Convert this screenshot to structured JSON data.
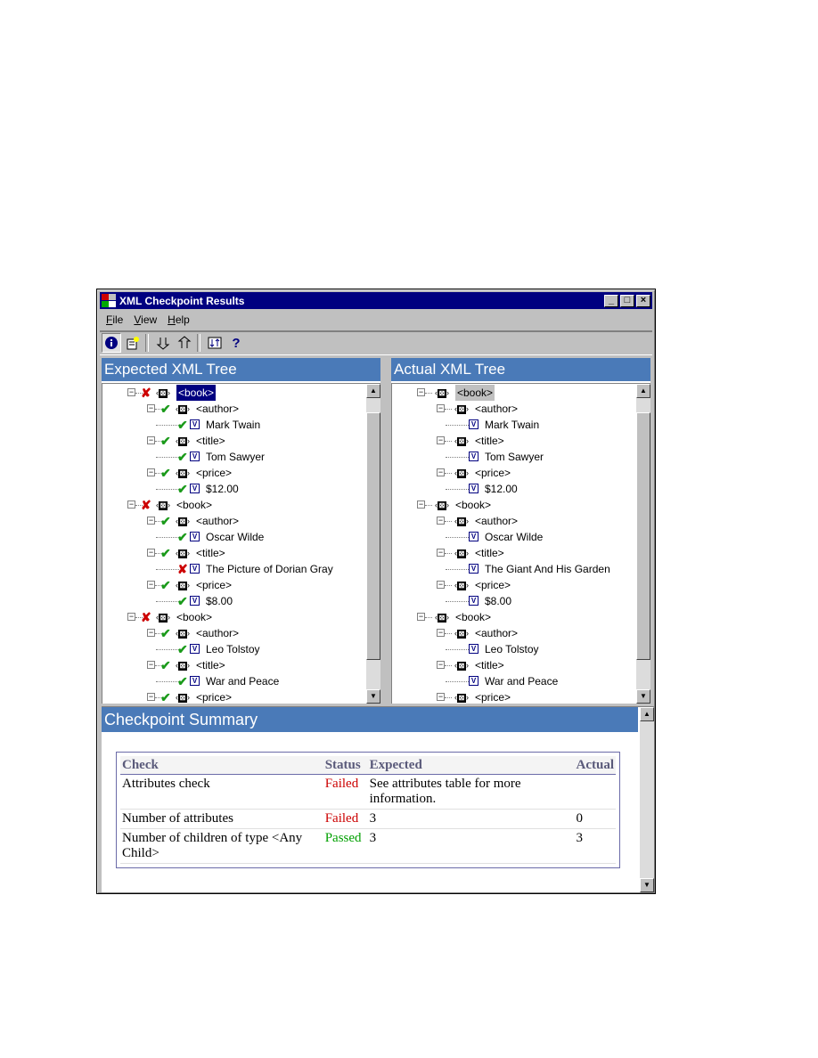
{
  "window": {
    "title": "XML Checkpoint Results"
  },
  "menu": [
    {
      "key": "F",
      "rest": "ile"
    },
    {
      "key": "V",
      "rest": "iew"
    },
    {
      "key": "H",
      "rest": "elp"
    }
  ],
  "colors": {
    "header": "#4a7ab8",
    "titlebar": "#000080",
    "failed": "#cc0000",
    "passed": "#00a000"
  },
  "expected": {
    "header": "Expected XML Tree",
    "rows": [
      {
        "depth": 0,
        "kind": "element",
        "status": "bad",
        "label": "<book>",
        "selected": true
      },
      {
        "depth": 1,
        "kind": "element",
        "status": "ok",
        "label": "<author>"
      },
      {
        "depth": 2,
        "kind": "value",
        "status": "ok",
        "label": "Mark Twain"
      },
      {
        "depth": 1,
        "kind": "element",
        "status": "ok",
        "label": "<title>"
      },
      {
        "depth": 2,
        "kind": "value",
        "status": "ok",
        "label": "Tom Sawyer"
      },
      {
        "depth": 1,
        "kind": "element",
        "status": "ok",
        "label": "<price>"
      },
      {
        "depth": 2,
        "kind": "value",
        "status": "ok",
        "label": "$12.00"
      },
      {
        "depth": 0,
        "kind": "element",
        "status": "bad",
        "label": "<book>"
      },
      {
        "depth": 1,
        "kind": "element",
        "status": "ok",
        "label": "<author>"
      },
      {
        "depth": 2,
        "kind": "value",
        "status": "ok",
        "label": "Oscar Wilde"
      },
      {
        "depth": 1,
        "kind": "element",
        "status": "ok",
        "label": "<title>"
      },
      {
        "depth": 2,
        "kind": "value",
        "status": "bad",
        "label": "The Picture of Dorian Gray"
      },
      {
        "depth": 1,
        "kind": "element",
        "status": "ok",
        "label": "<price>"
      },
      {
        "depth": 2,
        "kind": "value",
        "status": "ok",
        "label": "$8.00"
      },
      {
        "depth": 0,
        "kind": "element",
        "status": "bad",
        "label": "<book>"
      },
      {
        "depth": 1,
        "kind": "element",
        "status": "ok",
        "label": "<author>"
      },
      {
        "depth": 2,
        "kind": "value",
        "status": "ok",
        "label": "Leo Tolstoy"
      },
      {
        "depth": 1,
        "kind": "element",
        "status": "ok",
        "label": "<title>"
      },
      {
        "depth": 2,
        "kind": "value",
        "status": "ok",
        "label": "War and Peace"
      },
      {
        "depth": 1,
        "kind": "element",
        "status": "ok",
        "label": "<price>"
      }
    ]
  },
  "actual": {
    "header": "Actual XML Tree",
    "rows": [
      {
        "depth": 0,
        "kind": "element",
        "status": "",
        "label": "<book>",
        "highlighted": true
      },
      {
        "depth": 1,
        "kind": "element",
        "status": "",
        "label": "<author>"
      },
      {
        "depth": 2,
        "kind": "value",
        "status": "",
        "label": "Mark Twain"
      },
      {
        "depth": 1,
        "kind": "element",
        "status": "",
        "label": "<title>"
      },
      {
        "depth": 2,
        "kind": "value",
        "status": "",
        "label": "Tom Sawyer"
      },
      {
        "depth": 1,
        "kind": "element",
        "status": "",
        "label": "<price>"
      },
      {
        "depth": 2,
        "kind": "value",
        "status": "",
        "label": "$12.00"
      },
      {
        "depth": 0,
        "kind": "element",
        "status": "",
        "label": "<book>"
      },
      {
        "depth": 1,
        "kind": "element",
        "status": "",
        "label": "<author>"
      },
      {
        "depth": 2,
        "kind": "value",
        "status": "",
        "label": "Oscar Wilde"
      },
      {
        "depth": 1,
        "kind": "element",
        "status": "",
        "label": "<title>"
      },
      {
        "depth": 2,
        "kind": "value",
        "status": "",
        "label": "The Giant And His Garden"
      },
      {
        "depth": 1,
        "kind": "element",
        "status": "",
        "label": "<price>"
      },
      {
        "depth": 2,
        "kind": "value",
        "status": "",
        "label": "$8.00"
      },
      {
        "depth": 0,
        "kind": "element",
        "status": "",
        "label": "<book>"
      },
      {
        "depth": 1,
        "kind": "element",
        "status": "",
        "label": "<author>"
      },
      {
        "depth": 2,
        "kind": "value",
        "status": "",
        "label": "Leo Tolstoy"
      },
      {
        "depth": 1,
        "kind": "element",
        "status": "",
        "label": "<title>"
      },
      {
        "depth": 2,
        "kind": "value",
        "status": "",
        "label": "War and Peace"
      },
      {
        "depth": 1,
        "kind": "element",
        "status": "",
        "label": "<price>"
      }
    ]
  },
  "summary": {
    "header": "Checkpoint Summary",
    "columns": {
      "check": "Check",
      "status": "Status",
      "expected": "Expected",
      "actual": "Actual"
    },
    "rows": [
      {
        "check": "Attributes check",
        "status": "Failed",
        "expected": "See attributes table for more information.",
        "actual": ""
      },
      {
        "check": "Number of attributes",
        "status": "Failed",
        "expected": "3",
        "actual": "0"
      },
      {
        "check": "Number of children of type <Any Child>",
        "status": "Passed",
        "expected": "3",
        "actual": "3"
      }
    ]
  }
}
